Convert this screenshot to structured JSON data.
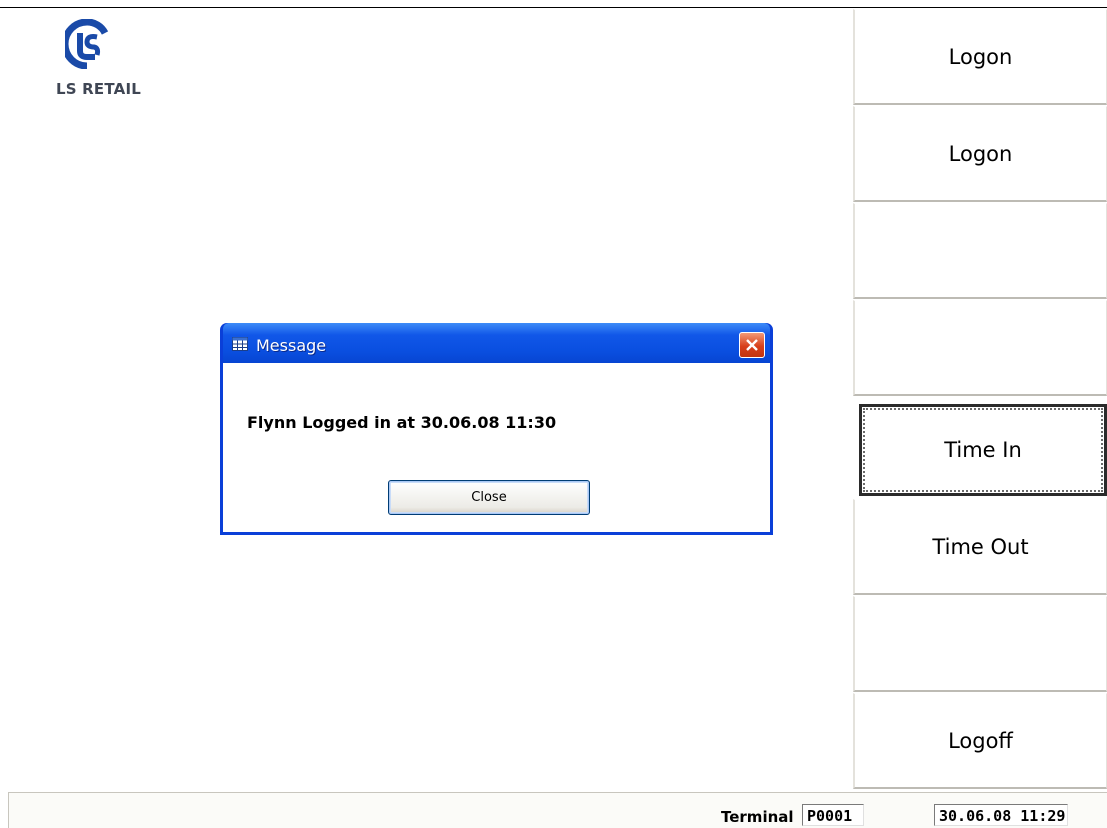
{
  "logo": {
    "text_bold": "LS RETA",
    "text_rest": "IL",
    "mark_color": "#1a4aa8"
  },
  "menu": {
    "buttons": [
      {
        "label": "Logon"
      },
      {
        "label": "Logon"
      },
      {
        "label": ""
      },
      {
        "label": ""
      },
      {
        "label": "Time In",
        "focused": true
      },
      {
        "label": "Time Out"
      },
      {
        "label": ""
      },
      {
        "label": "Logoff"
      }
    ]
  },
  "status_bar": {
    "terminal_label": "Terminal",
    "terminal_value": "P0001",
    "datetime": "30.06.08 11:29"
  },
  "dialog": {
    "title": "Message",
    "message": "Flynn Logged in at 30.06.08 11:30",
    "close_button": "Close",
    "icons": {
      "title": "table-icon",
      "close": "close-icon"
    },
    "colors": {
      "titlebar": "#0a4fe0",
      "close_button": "#d8401b"
    }
  }
}
